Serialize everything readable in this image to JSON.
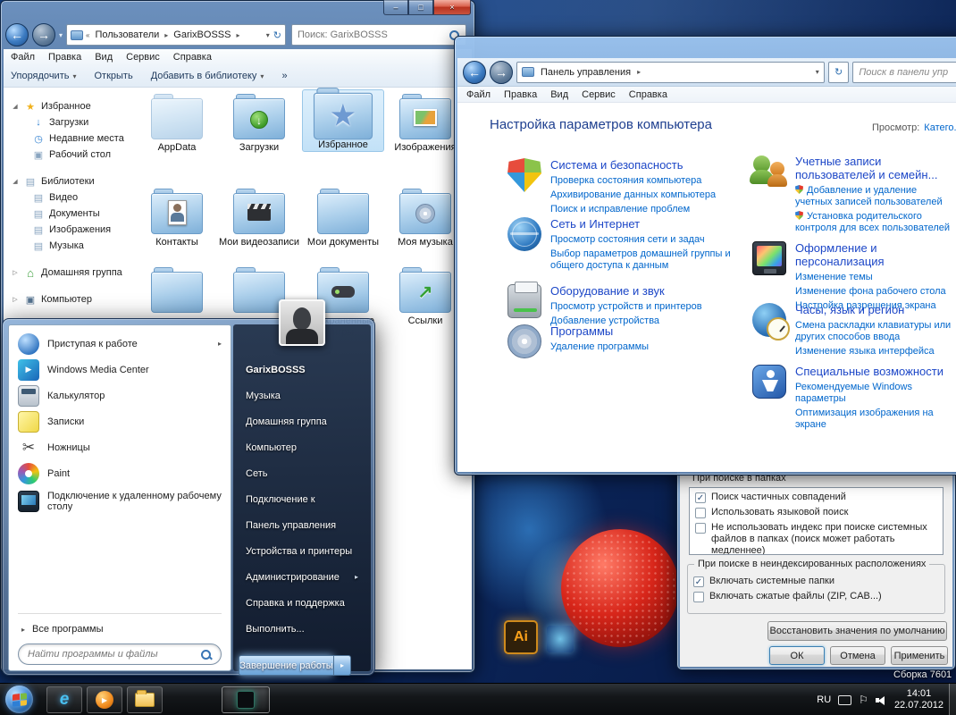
{
  "icons": {
    "back": "←",
    "forward": "→",
    "chevrons_left": "«",
    "crumb_sep": "▸",
    "dropdown": "▾",
    "refresh": "↻",
    "minimize": "–",
    "maximize": "□",
    "close": "×",
    "collapsed": "▷",
    "expanded": "◢",
    "submenu": "▸",
    "star": "★",
    "download": "↓",
    "recent": "◷",
    "desktop": "▣",
    "library": "▤",
    "house": "⌂",
    "computer": "▣",
    "overflow": "»",
    "check": "✓",
    "play": "▶",
    "ie": "e",
    "link_arrow": "↗",
    "scissors": "✂",
    "flag": "⚐",
    "all_programs": "▸"
  },
  "explorer": {
    "breadcrumb": {
      "root": "Пользователи",
      "current": "GarixBOSSS"
    },
    "search_value": "Поиск: GarixBOSSS",
    "menu": [
      "Файл",
      "Правка",
      "Вид",
      "Сервис",
      "Справка"
    ],
    "toolbar": {
      "organize": "Упорядочить",
      "open": "Открыть",
      "add_to_library": "Добавить в библиотеку"
    },
    "sidebar": [
      {
        "label": "Избранное",
        "children": [
          "Загрузки",
          "Недавние места",
          "Рабочий стол"
        ]
      },
      {
        "label": "Библиотеки",
        "children": [
          "Видео",
          "Документы",
          "Изображения",
          "Музыка"
        ]
      },
      {
        "label": "Домашняя группа",
        "children": []
      },
      {
        "label": "Компьютер",
        "children": []
      }
    ],
    "files": {
      "row1": [
        "AppData",
        "Загрузки",
        "Избранное",
        "Изображения"
      ],
      "row2": [
        "Контакты",
        "Мои видеозаписи",
        "Мои документы",
        "Моя музыка"
      ],
      "row3": [
        "Сохраненные игры",
        "Ссылки"
      ]
    }
  },
  "control_panel": {
    "address": "Панель управления",
    "search_placeholder": "Поиск в панели упр",
    "menu": [
      "Файл",
      "Правка",
      "Вид",
      "Сервис",
      "Справка"
    ],
    "heading": "Настройка параметров компьютера",
    "view_label": "Просмотр:",
    "view_value": "Катего...",
    "categories": [
      {
        "title": "Система и безопасность",
        "links": [
          "Проверка состояния компьютера",
          "Архивирование данных компьютера",
          "Поиск и исправление проблем"
        ]
      },
      {
        "title": "Сеть и Интернет",
        "links": [
          "Просмотр состояния сети и задач",
          "Выбор параметров домашней группы и общего доступа к данным"
        ]
      },
      {
        "title": "Оборудование и звук",
        "links": [
          "Просмотр устройств и принтеров",
          "Добавление устройства"
        ]
      },
      {
        "title": "Программы",
        "links": [
          "Удаление программы"
        ]
      },
      {
        "title": "Учетные записи пользователей и семейн...",
        "links": [
          "Добавление и удаление учетных записей пользователей",
          "Установка родительского контроля для всех пользователей"
        ]
      },
      {
        "title": "Оформление и персонализация",
        "links": [
          "Изменение темы",
          "Изменение фона рабочего стола",
          "Настройка разрешения экрана"
        ]
      },
      {
        "title": "Часы, язык и регион",
        "links": [
          "Смена раскладки клавиатуры или других способов ввода",
          "Изменение языка интерфейса"
        ]
      },
      {
        "title": "Специальные возможности",
        "links": [
          "Рекомендуемые Windows параметры",
          "Оптимизация изображения на экране"
        ]
      }
    ]
  },
  "folder_options": {
    "partial_group_label": "При поиске в папках",
    "search_options": [
      {
        "label": "Поиск частичных совпадений",
        "checked": true
      },
      {
        "label": "Использовать языковой поиск",
        "checked": false
      },
      {
        "label": "Не использовать индекс при поиске системных файлов в папках (поиск может работать медленнее)",
        "checked": false
      }
    ],
    "group_label": "При поиске в неиндексированных расположениях",
    "group_options": [
      {
        "label": "Включать системные папки",
        "checked": true
      },
      {
        "label": "Включать сжатые файлы (ZIP, CAB...)",
        "checked": false
      }
    ],
    "restore_button": "Восстановить значения по умолчанию",
    "ok_button": "ОК",
    "cancel_button": "Отмена",
    "apply_button": "Применить"
  },
  "start_menu": {
    "left_items": [
      "Приступая к работе",
      "Windows Media Center",
      "Калькулятор",
      "Записки",
      "Ножницы",
      "Paint",
      "Подключение к удаленному рабочему столу"
    ],
    "all_programs": "Все программы",
    "search_placeholder": "Найти программы и файлы",
    "user_name": "GarixBOSSS",
    "right_items": [
      "Музыка",
      "Домашняя группа",
      "Компьютер",
      "Сеть",
      "Подключение к",
      "Панель управления",
      "Устройства и принтеры",
      "Администрирование",
      "Справка и поддержка",
      "Выполнить..."
    ],
    "shutdown_label": "Завершение работы"
  },
  "taskbar": {
    "tray_lang": "RU",
    "tray_time": "14:01",
    "tray_date": "22.07.2012"
  },
  "wallpaper": {
    "build_label": "Сборка 7601",
    "dock_icon_ai": "Ai"
  }
}
